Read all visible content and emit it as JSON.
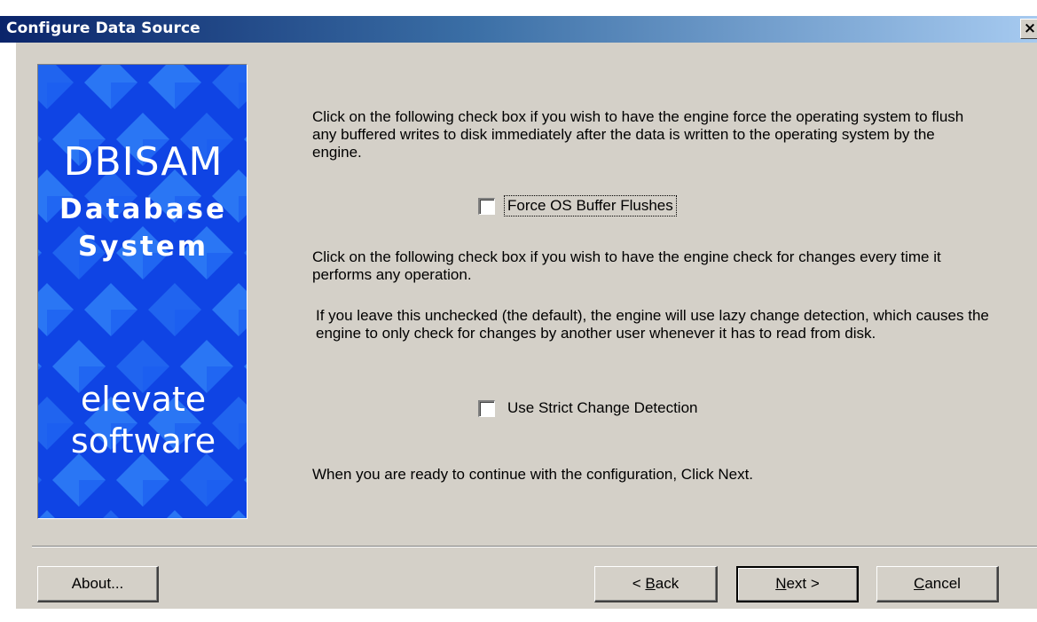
{
  "window": {
    "title": "Configure Data Source",
    "close_glyph": "×"
  },
  "banner": {
    "line1": "DBISAM",
    "line2": "Database",
    "line3": "System",
    "line4": "elevate",
    "line5": "software",
    "colors": {
      "background": "#0f44e4",
      "diamond": "#2f7ff7"
    }
  },
  "content": {
    "para_flush": "Click on the following check box if you wish to have the engine force the operating system to flush any buffered writes to disk immediately after the data is written to the operating system by the engine.",
    "checkbox_flush": {
      "label": "Force OS Buffer Flushes",
      "checked": false
    },
    "para_strict_1": "Click on the following check box if you wish to have the engine check for changes every time it performs any operation.",
    "para_strict_2": "If you leave this unchecked (the default), the engine will use lazy change detection, which causes the engine to only check for changes by another user whenever it has to read from disk.",
    "checkbox_strict": {
      "label": "Use Strict Change Detection",
      "checked": false
    },
    "para_next": "When you are ready to continue with the configuration, Click Next."
  },
  "buttons": {
    "about": "About...",
    "back_prefix": "< ",
    "back_mnemonic": "B",
    "back_rest": "ack",
    "next_mnemonic": "N",
    "next_rest": "ext >",
    "cancel_mnemonic": "C",
    "cancel_rest": "ancel"
  }
}
